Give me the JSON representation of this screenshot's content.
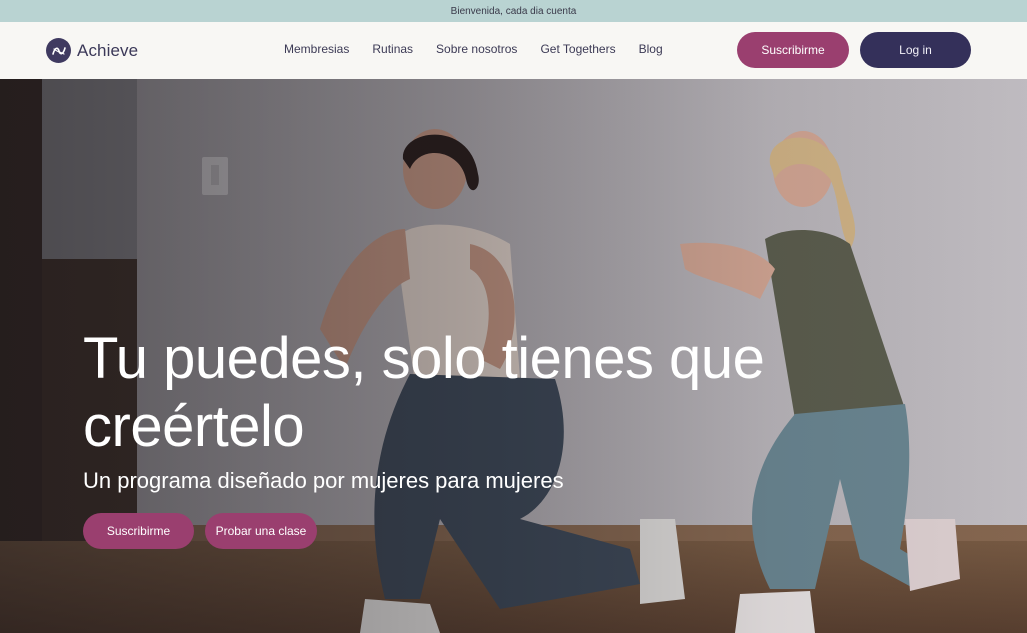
{
  "announcement": "Bienvenida, cada dia cuenta",
  "brand": {
    "name": "Achieve",
    "logo_icon": "abstract-ribbon-icon"
  },
  "nav": {
    "links": [
      "Membresias",
      "Rutinas",
      "Sobre nosotros",
      "Get Togethers",
      "Blog"
    ],
    "subscribe_label": "Suscribirme",
    "login_label": "Log in"
  },
  "hero": {
    "title": "Tu puedes, solo tienes que creértelo",
    "subtitle": "Un programa diseñado por mujeres para mujeres",
    "primary_cta": "Suscribirme",
    "secondary_cta": "Probar una clase"
  },
  "colors": {
    "accent": "#9a3f6f",
    "dark": "#34305a",
    "announcement_bg": "#b9d3d2",
    "nav_bg": "#f8f7f4"
  }
}
